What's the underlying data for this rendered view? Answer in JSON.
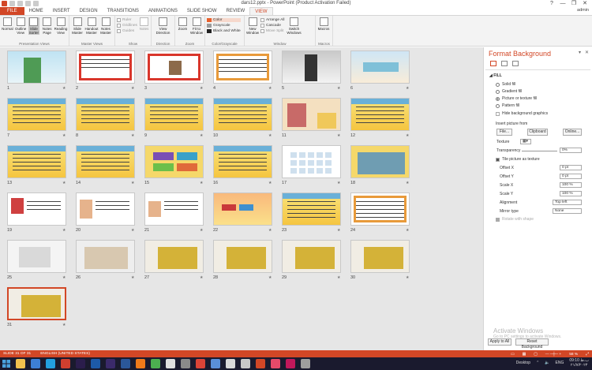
{
  "window": {
    "title": "dars12.pptx - PowerPoint (Product Activation Failed)",
    "controls": [
      "?",
      "—",
      "❐",
      "✕"
    ]
  },
  "tabs": {
    "file": "FILE",
    "items": [
      "HOME",
      "INSERT",
      "DESIGN",
      "TRANSITIONS",
      "ANIMATIONS",
      "SLIDE SHOW",
      "REVIEW",
      "VIEW"
    ],
    "active": "VIEW",
    "user": "admin"
  },
  "ribbon": {
    "presentation_views": {
      "label": "Presentation Views",
      "buttons": [
        "Normal",
        "Outline View",
        "Slide Sorter",
        "Notes Page",
        "Reading View"
      ]
    },
    "master_views": {
      "label": "Master Views",
      "buttons": [
        "Slide Master",
        "Handout Master",
        "Notes Master"
      ]
    },
    "show": {
      "label": "Show",
      "checks": [
        "Ruler",
        "Gridlines",
        "Guides"
      ],
      "notes": "Notes"
    },
    "direction": {
      "label": "Direction",
      "button": "View Direction"
    },
    "zoom": {
      "label": "Zoom",
      "buttons": [
        "Zoom",
        "Fit to Window"
      ]
    },
    "color": {
      "label": "Color/Grayscale",
      "items": [
        "Color",
        "Grayscale",
        "Black and White"
      ]
    },
    "window": {
      "label": "Window",
      "new_window": "New Window",
      "items": [
        "Arrange All",
        "Cascade",
        "Move Split"
      ],
      "switch": "Switch Windows"
    },
    "macros": {
      "label": "Macros",
      "button": "Macros"
    }
  },
  "slides": [
    {
      "num": "1"
    },
    {
      "num": "2"
    },
    {
      "num": "3"
    },
    {
      "num": "4"
    },
    {
      "num": "5"
    },
    {
      "num": "6"
    },
    {
      "num": "7"
    },
    {
      "num": "8"
    },
    {
      "num": "9"
    },
    {
      "num": "10"
    },
    {
      "num": "11"
    },
    {
      "num": "12"
    },
    {
      "num": "13"
    },
    {
      "num": "14"
    },
    {
      "num": "15"
    },
    {
      "num": "16"
    },
    {
      "num": "17"
    },
    {
      "num": "18"
    },
    {
      "num": "19"
    },
    {
      "num": "20"
    },
    {
      "num": "21"
    },
    {
      "num": "22"
    },
    {
      "num": "23"
    },
    {
      "num": "24"
    },
    {
      "num": "25"
    },
    {
      "num": "26"
    },
    {
      "num": "27"
    },
    {
      "num": "28"
    },
    {
      "num": "29"
    },
    {
      "num": "30"
    },
    {
      "num": "31"
    }
  ],
  "pane": {
    "title": "Format Background",
    "section": "FILL",
    "options": [
      "Solid fill",
      "Gradient fill",
      "Picture or texture fill",
      "Pattern fill"
    ],
    "selected_option": "Picture or texture fill",
    "hide_graphics": "Hide background graphics",
    "insert_from": "Insert picture from",
    "file_btn": "File...",
    "clipboard_btn": "Clipboard",
    "online_btn": "Online...",
    "texture_label": "Texture",
    "transparency_label": "Transparency",
    "transparency_value": "0%",
    "tile_label": "Tile picture as texture",
    "offset_x_label": "Offset X",
    "offset_x": "0 pt",
    "offset_y_label": "Offset Y",
    "offset_y": "0 pt",
    "scale_x_label": "Scale X",
    "scale_x": "100 %",
    "scale_y_label": "Scale Y",
    "scale_y": "100 %",
    "alignment_label": "Alignment",
    "alignment": "Top left",
    "mirror_label": "Mirror type",
    "mirror": "None",
    "rotate_label": "Rotate with shape",
    "apply_all": "Apply to All",
    "reset": "Reset Background"
  },
  "activation": {
    "line1": "Activate Windows",
    "line2": "Go to PC settings to activate Windows."
  },
  "status": {
    "slide": "SLIDE 31 OF 31",
    "language": "ENGLISH (UNITED STATES)",
    "zoom": "58 %"
  },
  "taskbar": {
    "desktop": "Desktop",
    "lang": "ENG",
    "time": "09:10 ب.ظ",
    "date": "۲۱/۷/۲۰۲۴"
  },
  "colors": {
    "accent": "#d24726"
  }
}
